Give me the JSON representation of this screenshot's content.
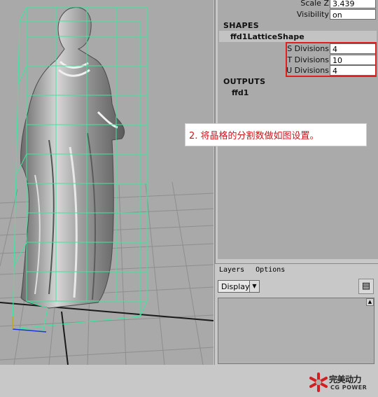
{
  "attributes": {
    "scale_z": {
      "label": "Scale Z",
      "value": "3.439"
    },
    "visibility": {
      "label": "Visibility",
      "value": "on"
    }
  },
  "shapes": {
    "header": "SHAPES",
    "node": "ffd1LatticeShape",
    "s_divisions": {
      "label": "S Divisions",
      "value": "4"
    },
    "t_divisions": {
      "label": "T Divisions",
      "value": "10"
    },
    "u_divisions": {
      "label": "U Divisions",
      "value": "4"
    }
  },
  "outputs": {
    "header": "OUTPUTS",
    "node": "ffd1"
  },
  "annotation": "2. 将晶格的分割数做如图设置。",
  "layers": {
    "menu": [
      "Layers",
      "Options"
    ],
    "display_option": "Display"
  },
  "watermark": {
    "title": "完美动力",
    "subtitle": "CG POWER"
  },
  "colors": {
    "highlight_box": "#e0201c",
    "annotation_text": "#d0131b",
    "lattice": "#3de8a0"
  }
}
